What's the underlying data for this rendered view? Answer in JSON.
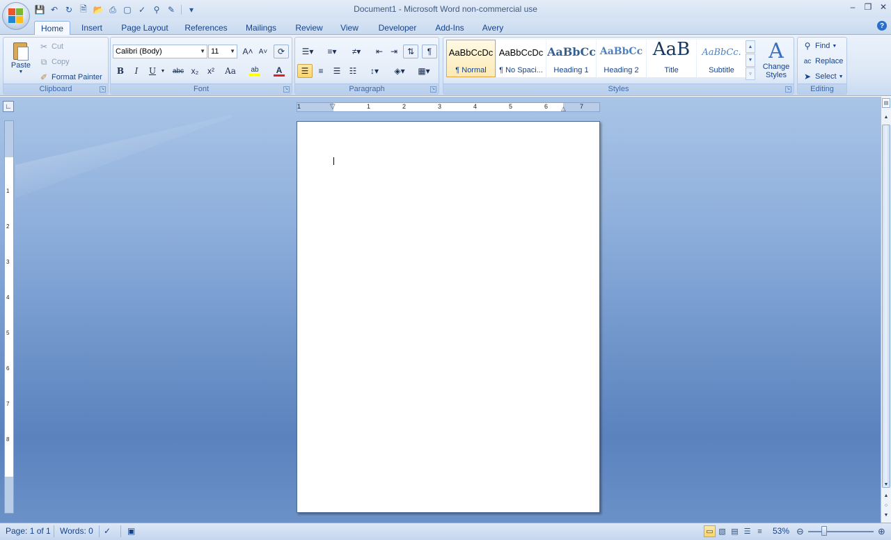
{
  "window": {
    "title": "Document1 - Microsoft Word non-commercial use",
    "minimize": "–",
    "restore": "❐",
    "close": "✕"
  },
  "quick_access": {
    "save": "💾",
    "undo": "↶",
    "redo": "↻",
    "new": "🗎",
    "open": "📂",
    "more": "▾"
  },
  "tabs": [
    "Home",
    "Insert",
    "Page Layout",
    "References",
    "Mailings",
    "Review",
    "View",
    "Developer",
    "Add-Ins",
    "Avery"
  ],
  "active_tab": "Home",
  "help": "?",
  "clipboard": {
    "paste": "Paste",
    "cut": "Cut",
    "copy": "Copy",
    "format_painter": "Format Painter",
    "label": "Clipboard"
  },
  "font": {
    "name": "Calibri (Body)",
    "size": "11",
    "grow": "A˄",
    "shrink": "A˅",
    "bold": "B",
    "italic": "I",
    "underline": "U",
    "strikethrough": "abc",
    "subscript": "x₂",
    "superscript": "x²",
    "change_case": "Aa",
    "highlight": "ab",
    "font_color": "A",
    "label": "Font"
  },
  "paragraph": {
    "label": "Paragraph",
    "show_marks": "¶"
  },
  "styles": {
    "label": "Styles",
    "items": [
      {
        "sample": "AaBbCcDc",
        "name": "¶ Normal",
        "selected": true
      },
      {
        "sample": "AaBbCcDc",
        "name": "¶ No Spaci...",
        "selected": false
      },
      {
        "sample": "AaBbCc",
        "name": "Heading 1",
        "selected": false
      },
      {
        "sample": "AaBbCc",
        "name": "Heading 2",
        "selected": false
      },
      {
        "sample": "AaB",
        "name": "Title",
        "selected": false
      },
      {
        "sample": "AaBbCc.",
        "name": "Subtitle",
        "selected": false
      }
    ],
    "change_styles_1": "Change",
    "change_styles_2": "Styles"
  },
  "editing": {
    "label": "Editing",
    "find": "Find",
    "replace": "Replace",
    "select": "Select"
  },
  "ruler": {
    "h_numbers": [
      "1",
      "1",
      "2",
      "3",
      "4",
      "5",
      "6",
      "7"
    ],
    "v_numbers": [
      "1",
      "2",
      "3",
      "4",
      "5",
      "6",
      "7",
      "8"
    ]
  },
  "status": {
    "page": "Page: 1 of 1",
    "words": "Words: 0",
    "zoom": "53%"
  },
  "colors": {
    "accent": "#15428b",
    "highlight": "#fbd568",
    "font_color_bar": "#e31c1c",
    "highlight_bar": "#ffff00"
  }
}
